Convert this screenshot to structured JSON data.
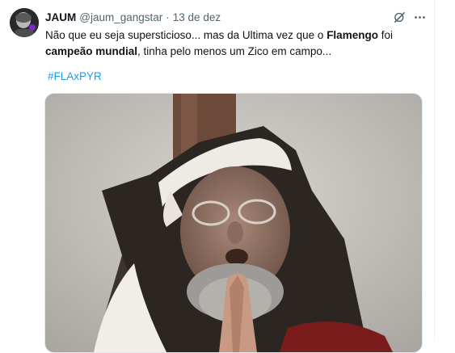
{
  "tweet": {
    "display_name": "JAUM",
    "handle": "@jaum_gangstar",
    "separator": "·",
    "date": "13 de dez",
    "text_parts": {
      "p1": "Não que eu seja supersticioso... mas da Ultima vez que o ",
      "b1": "Flamengo",
      "p2": " foi ",
      "b2": "campeão mundial",
      "p3": ", tinha pelo menos um Zico em campo..."
    },
    "hashtag": "#FLAxPYR",
    "icons": {
      "grok": "grok-icon",
      "more": "more-icon"
    },
    "media": "praying-person-gif"
  },
  "colors": {
    "accent": "#1d9bf0",
    "text": "#0f1419",
    "secondary": "#536471",
    "border": "#eff3f4"
  }
}
